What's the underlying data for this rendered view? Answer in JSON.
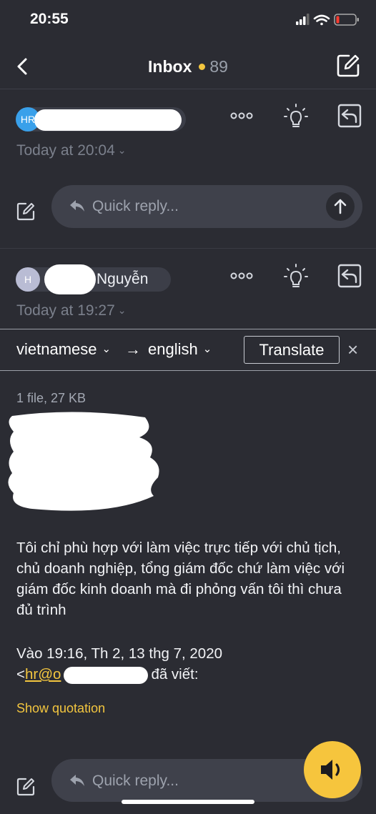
{
  "status_bar": {
    "time": "20:55"
  },
  "nav": {
    "title": "Inbox",
    "count": "89"
  },
  "messages": [
    {
      "avatar": "HR",
      "avatar_color": "#39a0ea",
      "sender": "",
      "timestamp": "Today at 20:04"
    },
    {
      "avatar": "H",
      "avatar_color": "#b9bcd4",
      "sender": "Nguyễn",
      "timestamp": "Today at 19:27"
    }
  ],
  "quick_reply": {
    "placeholder": "Quick reply..."
  },
  "translate_bar": {
    "source_lang": "vietnamese",
    "arrow": "→",
    "target_lang": "english",
    "button": "Translate",
    "close": "×"
  },
  "attachment": {
    "info": "1 file, 27 KB"
  },
  "body": {
    "text": "Tôi chỉ phù hợp với làm việc trực tiếp với chủ tịch, chủ doanh nghiệp, tổng giám đốc chứ làm việc với giám đốc kinh doanh mà đi phỏng vấn tôi thì chưa đủ trình"
  },
  "quote": {
    "date_line": "Vào 19:16, Th 2, 13 thg 7, 2020",
    "lt": "<",
    "email_prefix": "hr@o",
    "wrote": "đã viết:",
    "show_quotation": "Show quotation"
  },
  "colors": {
    "background": "#2b2c33",
    "accent": "#f3c63f",
    "pill": "#3f414b"
  },
  "icons": [
    "back-chevron-icon",
    "compose-icon",
    "more-dots-icon",
    "lightbulb-icon",
    "reply-icon",
    "send-arrow-icon",
    "reply-arrow-icon",
    "speaker-icon",
    "close-icon"
  ]
}
